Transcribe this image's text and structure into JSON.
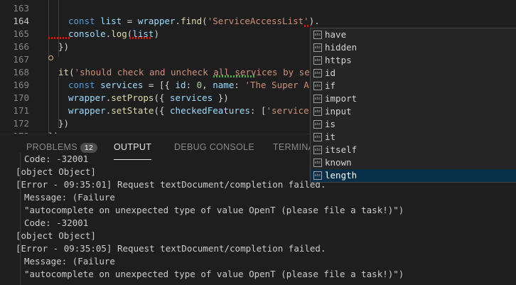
{
  "editor": {
    "lines": [
      {
        "num": "163",
        "tokens": []
      },
      {
        "num": "164",
        "active": true,
        "tokens": [
          {
            "t": "const ",
            "c": "kw"
          },
          {
            "t": "list",
            "c": "var"
          },
          {
            "t": " = ",
            "c": ""
          },
          {
            "t": "wrapper",
            "c": "var"
          },
          {
            "t": ".",
            "c": ""
          },
          {
            "t": "find",
            "c": "fn"
          },
          {
            "t": "(",
            "c": ""
          },
          {
            "t": "'ServiceAccessList'",
            "c": "str"
          },
          {
            "t": ").",
            "c": ""
          }
        ]
      },
      {
        "num": "165",
        "tokens": [
          {
            "t": "console",
            "c": "var"
          },
          {
            "t": ".",
            "c": ""
          },
          {
            "t": "log",
            "c": "fn"
          },
          {
            "t": "(",
            "c": ""
          },
          {
            "t": "list",
            "c": "var"
          },
          {
            "t": ")",
            "c": ""
          }
        ]
      },
      {
        "num": "166",
        "tokens": [
          {
            "t": "})",
            "c": ""
          }
        ]
      },
      {
        "num": "167",
        "tokens": []
      },
      {
        "num": "168",
        "tokens": [
          {
            "t": "it",
            "c": "fn"
          },
          {
            "t": "(",
            "c": ""
          },
          {
            "t": "'should check and uncheck all services by sele",
            "c": "str"
          }
        ]
      },
      {
        "num": "169",
        "tokens": [
          {
            "t": "const ",
            "c": "kw"
          },
          {
            "t": "services",
            "c": "var"
          },
          {
            "t": " = [{ ",
            "c": ""
          },
          {
            "t": "id",
            "c": "var"
          },
          {
            "t": ": ",
            "c": ""
          },
          {
            "t": "0",
            "c": "num"
          },
          {
            "t": ", ",
            "c": ""
          },
          {
            "t": "name",
            "c": "var"
          },
          {
            "t": ": ",
            "c": ""
          },
          {
            "t": "'The Super API",
            "c": "str"
          }
        ]
      },
      {
        "num": "170",
        "tokens": [
          {
            "t": "wrapper",
            "c": "var"
          },
          {
            "t": ".",
            "c": ""
          },
          {
            "t": "setProps",
            "c": "fn"
          },
          {
            "t": "({ ",
            "c": ""
          },
          {
            "t": "services",
            "c": "var"
          },
          {
            "t": " })",
            "c": ""
          }
        ]
      },
      {
        "num": "171",
        "tokens": [
          {
            "t": "wrapper",
            "c": "var"
          },
          {
            "t": ".",
            "c": ""
          },
          {
            "t": "setState",
            "c": "fn"
          },
          {
            "t": "({ ",
            "c": ""
          },
          {
            "t": "checkedFeatures",
            "c": "var"
          },
          {
            "t": ": [",
            "c": ""
          },
          {
            "t": "'services'",
            "c": "str"
          }
        ]
      },
      {
        "num": "172",
        "tokens": [
          {
            "t": "})",
            "c": ""
          }
        ]
      },
      {
        "num": "173",
        "tokens": [
          {
            "t": "})",
            "c": ""
          }
        ]
      }
    ]
  },
  "panel": {
    "tabs": {
      "problems": "PROBLEMS",
      "problems_count": "12",
      "output": "OUTPUT",
      "debug_console": "DEBUG CONSOLE",
      "terminal": "TERMINAL"
    },
    "output_lines": [
      {
        "text": "Code: -32001",
        "indent": true
      },
      {
        "text": "[object Object]",
        "indent": false
      },
      {
        "text": "[Error - 09:35:01] Request textDocument/completion failed.",
        "indent": false
      },
      {
        "text": "Message: (Failure",
        "indent": true
      },
      {
        "text": "\"autocomplete on unexpected type of value OpenT (please file a task!)\")",
        "indent": true
      },
      {
        "text": "Code: -32001",
        "indent": true
      },
      {
        "text": "[object Object]",
        "indent": false
      },
      {
        "text": "[Error - 09:35:05] Request textDocument/completion failed.",
        "indent": false
      },
      {
        "text": "Message: (Failure",
        "indent": true
      },
      {
        "text": "\"autocomplete on unexpected type of value OpenT (please file a task!)\")",
        "indent": true
      }
    ]
  },
  "suggest": {
    "icon_text": "abc",
    "items": [
      "have",
      "hidden",
      "https",
      "id",
      "if",
      "import",
      "input",
      "is",
      "it",
      "itself",
      "known",
      "length"
    ],
    "selected_index": 11
  }
}
